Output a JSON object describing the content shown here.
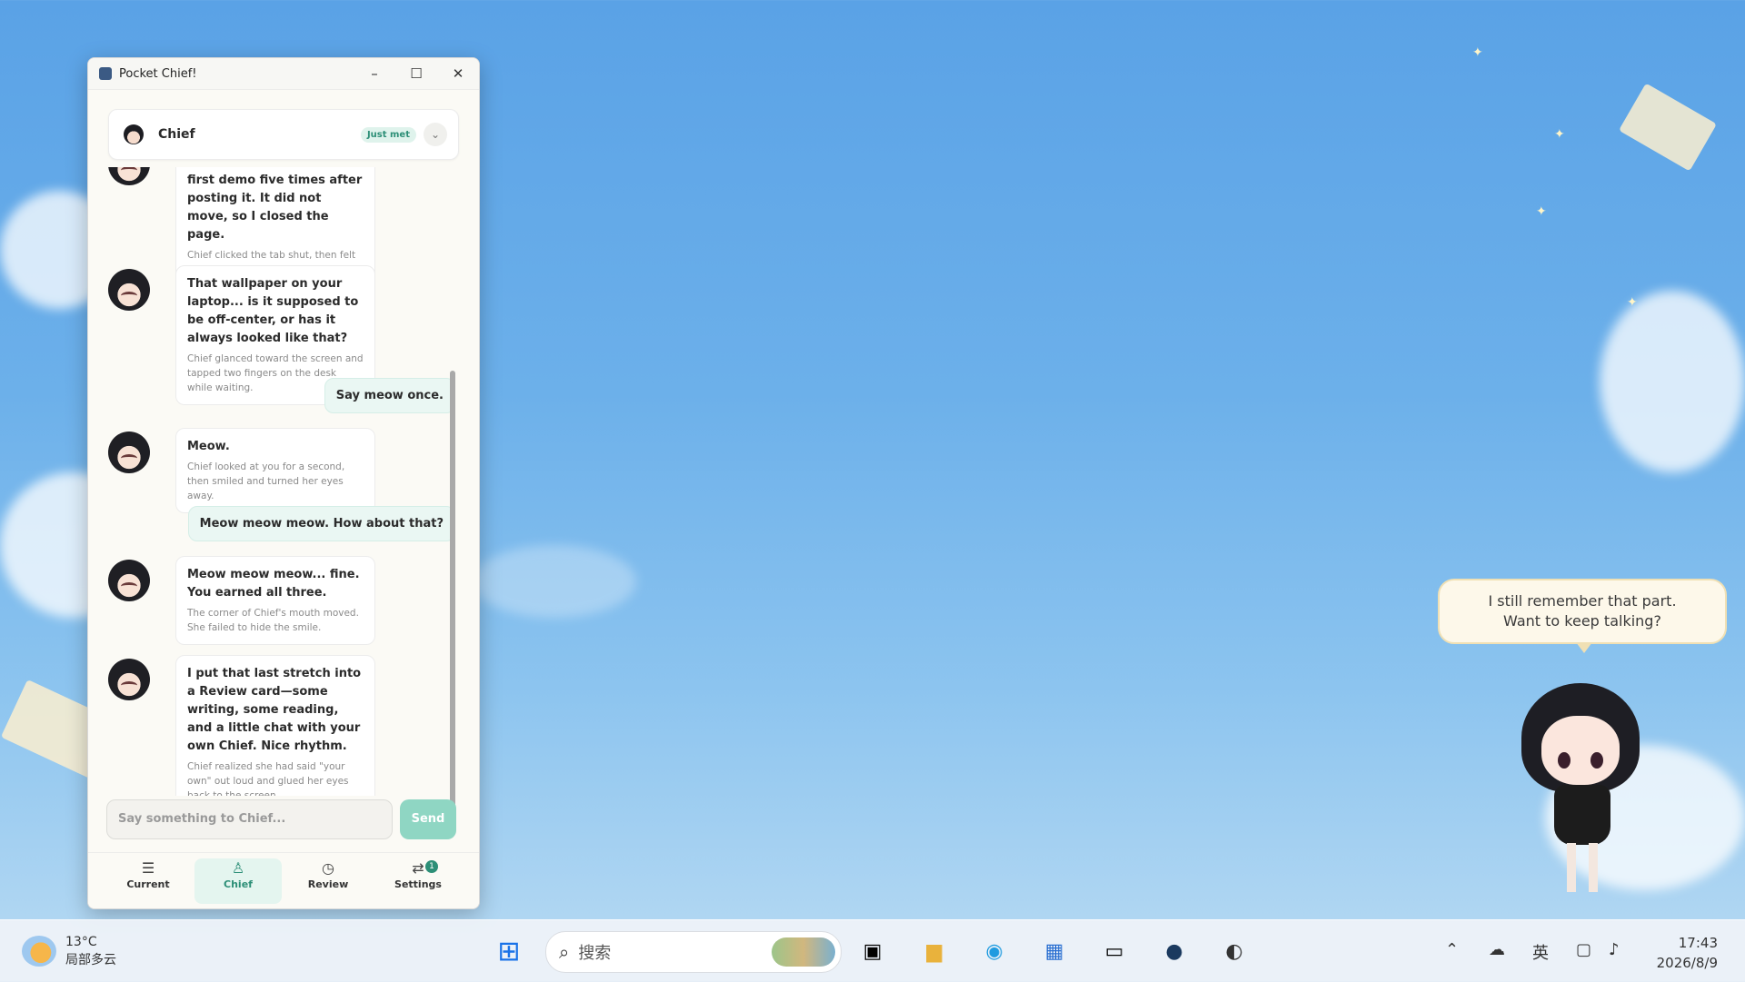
{
  "window": {
    "title": "Pocket Chief!"
  },
  "header": {
    "name": "Chief",
    "badge": "Just met"
  },
  "messages": [
    {
      "text": "first demo five times after posting it. It did not move, so I closed the page.",
      "note": "Chief clicked the tab shut, then felt a little silly about it."
    },
    {
      "text": "That wallpaper on your laptop... is it supposed to be off-center, or has it always looked like that?",
      "note": "Chief glanced toward the screen and tapped two fingers on the desk while waiting."
    },
    {
      "text": "Meow.",
      "note": "Chief looked at you for a second, then smiled and turned her eyes away."
    },
    {
      "text": "Meow meow meow... fine. You earned all three.",
      "note": "The corner of Chief's mouth moved. She failed to hide the smile."
    },
    {
      "text": "I put that last stretch into a Review card—some writing, some reading, and a little chat with your own Chief. Nice rhythm.",
      "note": "Chief realized she had said \"your own\" out loud and glued her eyes back to the screen."
    }
  ],
  "user_messages": [
    {
      "text": "Say meow once."
    },
    {
      "text": "Meow meow meow. How about that?"
    }
  ],
  "composer": {
    "placeholder": "Say something to Chief...",
    "send_label": "Send"
  },
  "nav": [
    {
      "label": "Current",
      "icon": "list-icon"
    },
    {
      "label": "Chief",
      "icon": "person-icon"
    },
    {
      "label": "Review",
      "icon": "clock-icon"
    },
    {
      "label": "Settings",
      "icon": "sliders-icon",
      "badge": "1"
    }
  ],
  "pet": {
    "speech_line1": "I still remember that part.",
    "speech_line2": "Want to keep talking?"
  },
  "taskbar": {
    "weather_temp": "13°C",
    "weather_desc": "局部多云",
    "search_placeholder": "搜索",
    "ime": "英",
    "time": "17:43",
    "date": "2026/8/9"
  },
  "colors": {
    "accent": "#2d8f77",
    "send": "#8fd6c3",
    "user_bubble": "#eaf7f3"
  }
}
